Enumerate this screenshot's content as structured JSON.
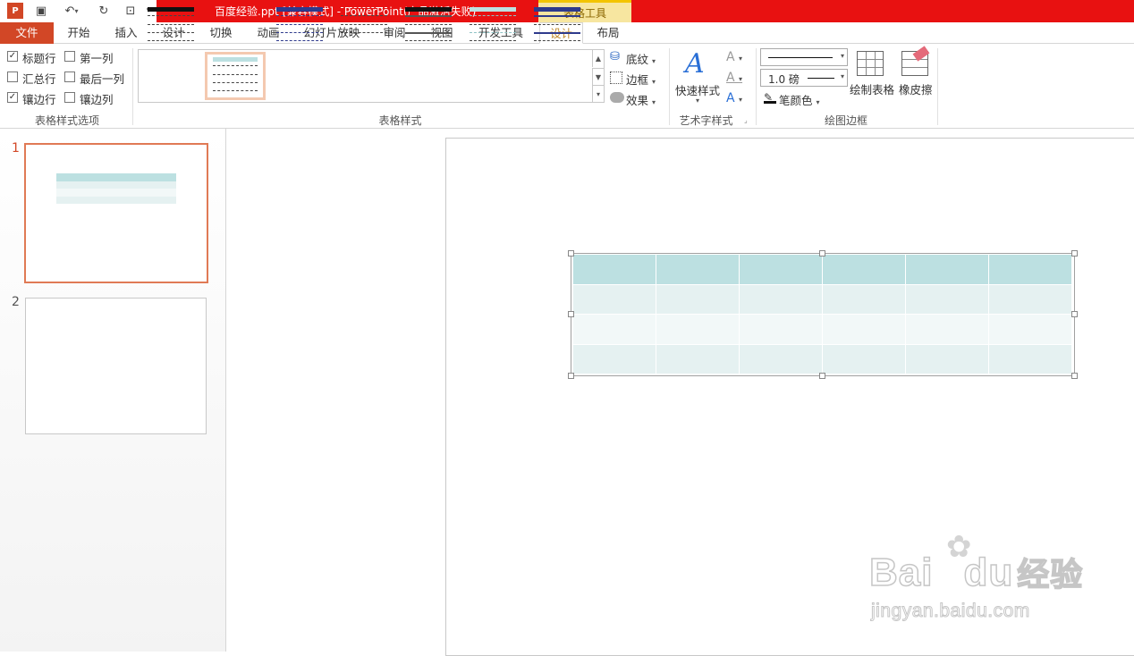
{
  "titlebar": {
    "title": "百度经验.ppt [兼容模式] -  PowerPoint(产品激活失败)",
    "context_tools": "表格工具"
  },
  "tabs": [
    "文件",
    "开始",
    "插入",
    "设计",
    "切换",
    "动画",
    "幻灯片放映",
    "审阅",
    "视图",
    "开发工具",
    "设计",
    "布局"
  ],
  "options_group": {
    "header_row": "标题行",
    "first_column": "第一列",
    "total_row": "汇总行",
    "last_column": "最后一列",
    "banded_rows": "镶边行",
    "banded_columns": "镶边列",
    "label": "表格样式选项"
  },
  "styles_group": {
    "shading": "底纹",
    "borders": "边框",
    "effects": "效果",
    "label": "表格样式"
  },
  "wordart_group": {
    "quick_styles": "快速样式",
    "label": "艺术字样式"
  },
  "draw_group": {
    "pen_weight": "1.0 磅",
    "pen_color": "笔颜色",
    "draw_table": "绘制表格",
    "eraser": "橡皮擦",
    "label": "绘图边框"
  },
  "thumbnails": [
    "1",
    "2"
  ],
  "watermark": {
    "brand": "Bai",
    "brand2": "du",
    "cn": "经验",
    "url": "jingyan.baidu.com"
  },
  "colors": {
    "accent_red": "#e81111",
    "file_tab": "#d24726",
    "table_header": "#bce0e1",
    "table_band": "#e5f1f1"
  }
}
